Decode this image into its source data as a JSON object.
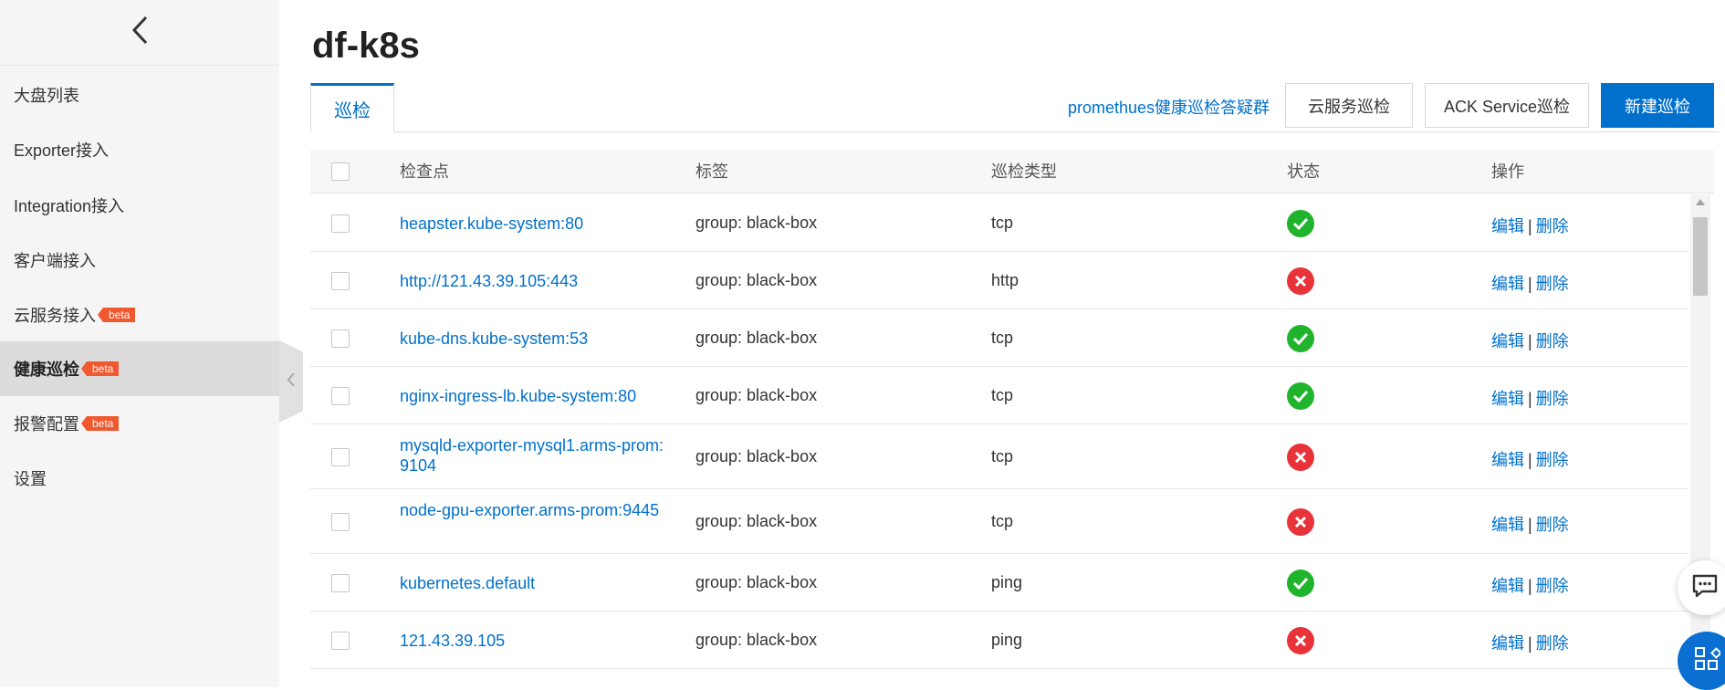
{
  "sidebar": {
    "back_icon": "chevron-left-icon",
    "items": [
      {
        "label": "大盘列表",
        "badge": "",
        "active": false
      },
      {
        "label": "Exporter接入",
        "badge": "",
        "active": false
      },
      {
        "label": "Integration接入",
        "badge": "",
        "active": false
      },
      {
        "label": "客户端接入",
        "badge": "",
        "active": false
      },
      {
        "label": "云服务接入",
        "badge": "beta",
        "active": false
      },
      {
        "label": "健康巡检",
        "badge": "beta",
        "active": true
      },
      {
        "label": "报警配置",
        "badge": "beta",
        "active": false
      },
      {
        "label": "设置",
        "badge": "",
        "active": false
      }
    ]
  },
  "header": {
    "title": "df-k8s"
  },
  "tabs": [
    {
      "label": "巡检",
      "active": true
    }
  ],
  "toolbar": {
    "link_label": "promethues健康巡检答疑群",
    "cloud_btn": "云服务巡检",
    "ack_btn": "ACK Service巡检",
    "new_btn": "新建巡检"
  },
  "table": {
    "columns": {
      "checkpoint": "检查点",
      "tags": "标签",
      "type": "巡检类型",
      "status": "状态",
      "actions": "操作"
    },
    "edit_label": "编辑",
    "delete_label": "删除",
    "rows": [
      {
        "checkpoint": "heapster.kube-system:80",
        "tag": "group: black-box",
        "type": "tcp",
        "status": "ok"
      },
      {
        "checkpoint": "http://121.43.39.105:443",
        "tag": "group: black-box",
        "type": "http",
        "status": "error"
      },
      {
        "checkpoint": "kube-dns.kube-system:53",
        "tag": "group: black-box",
        "type": "tcp",
        "status": "ok"
      },
      {
        "checkpoint": "nginx-ingress-lb.kube-system:80",
        "tag": "group: black-box",
        "type": "tcp",
        "status": "ok"
      },
      {
        "checkpoint": "mysqld-exporter-mysql1.arms-prom:9104",
        "tag": "group: black-box",
        "type": "tcp",
        "status": "error"
      },
      {
        "checkpoint": "node-gpu-exporter.arms-prom:9445",
        "tag": "group: black-box",
        "type": "tcp",
        "status": "error"
      },
      {
        "checkpoint": "kubernetes.default",
        "tag": "group: black-box",
        "type": "ping",
        "status": "ok"
      },
      {
        "checkpoint": "121.43.39.105",
        "tag": "group: black-box",
        "type": "ping",
        "status": "error"
      }
    ]
  },
  "colors": {
    "primary": "#0070cc",
    "ok": "#1fb42b",
    "error": "#e8333a",
    "badge": "#f0582f"
  }
}
